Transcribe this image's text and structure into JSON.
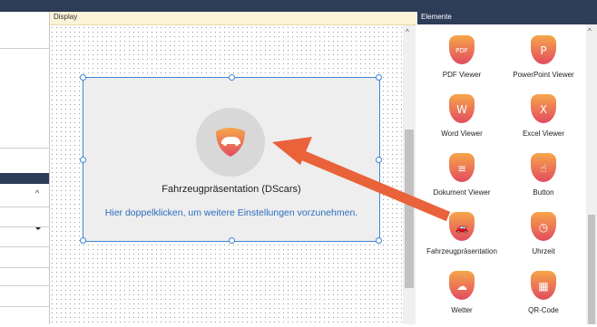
{
  "display": {
    "title": "Display",
    "widget": {
      "title": "Fahrzeugpräsentation (DScars)",
      "hint": "Hier doppelklicken, um weitere Einstellungen vorzunehmen."
    }
  },
  "elements": {
    "title": "Elemente",
    "items": [
      {
        "label": "PDF Viewer",
        "icon": "pdf-document-icon",
        "glyph": "PDF"
      },
      {
        "label": "PowerPoint Viewer",
        "icon": "powerpoint-document-icon",
        "glyph": "P"
      },
      {
        "label": "Word Viewer",
        "icon": "word-document-icon",
        "glyph": "W"
      },
      {
        "label": "Excel Viewer",
        "icon": "excel-document-icon",
        "glyph": "X"
      },
      {
        "label": "Dokument Viewer",
        "icon": "document-icon",
        "glyph": "≡"
      },
      {
        "label": "Button",
        "icon": "touch-button-icon",
        "glyph": "☝"
      },
      {
        "label": "Fahrzeugpräsentation",
        "icon": "car-icon",
        "glyph": "🚗"
      },
      {
        "label": "Uhrzeit",
        "icon": "clock-icon",
        "glyph": "◷"
      },
      {
        "label": "Wetter",
        "icon": "weather-icon",
        "glyph": "☁"
      },
      {
        "label": "QR-Code",
        "icon": "qr-code-icon",
        "glyph": "▦"
      }
    ]
  },
  "colors": {
    "header_dark": "#2d3c57",
    "display_header": "#fcf3d8",
    "selection_blue": "#3b86d6",
    "arrow_orange": "#e9623a",
    "icon_gradient_top": "#f6a64a",
    "icon_gradient_bottom": "#e24b5f"
  }
}
